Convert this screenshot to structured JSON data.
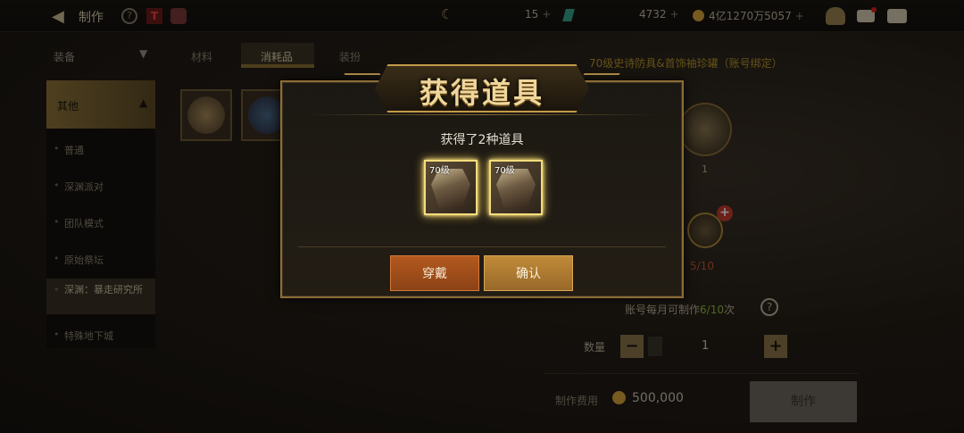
{
  "topbar": {
    "back_icon": "back-arrow-icon",
    "title": "制作",
    "currency": {
      "moon_value": "15",
      "gem_value": "4732",
      "gold_value": "4亿1270万5057"
    }
  },
  "left_panel": {
    "filter_label": "装备",
    "category_header": "其他",
    "categories": [
      "普通",
      "深渊派对",
      "团队模式",
      "原始祭坛",
      "深渊：暴走研究所",
      "特殊地下城"
    ],
    "selected_category_index": 4
  },
  "tabs": [
    "材料",
    "消耗品",
    "装扮"
  ],
  "active_tab_index": 1,
  "right_panel": {
    "reward_title": "70级史诗防具&首饰袖珍罐（账号绑定）",
    "preview_count": "1",
    "material_count": "5/10",
    "monthly_limit_prefix": "账号每月可制作",
    "monthly_limit_value": "6/10",
    "monthly_limit_suffix": "次",
    "quantity_label": "数量",
    "quantity_value": "1",
    "cost_label": "制作费用",
    "cost_value": "500,000",
    "make_button": "制作"
  },
  "modal": {
    "title": "获得道具",
    "subtitle": "获得了2种道具",
    "items": [
      {
        "level_label": "70级"
      },
      {
        "level_label": "70级"
      }
    ],
    "equip_button": "穿戴",
    "confirm_button": "确认"
  },
  "colors": {
    "accent_gold": "#c59a48",
    "equip_button": "#b3591f",
    "confirm_button": "#c08a38",
    "monthly_highlight": "#8fbf3b"
  }
}
